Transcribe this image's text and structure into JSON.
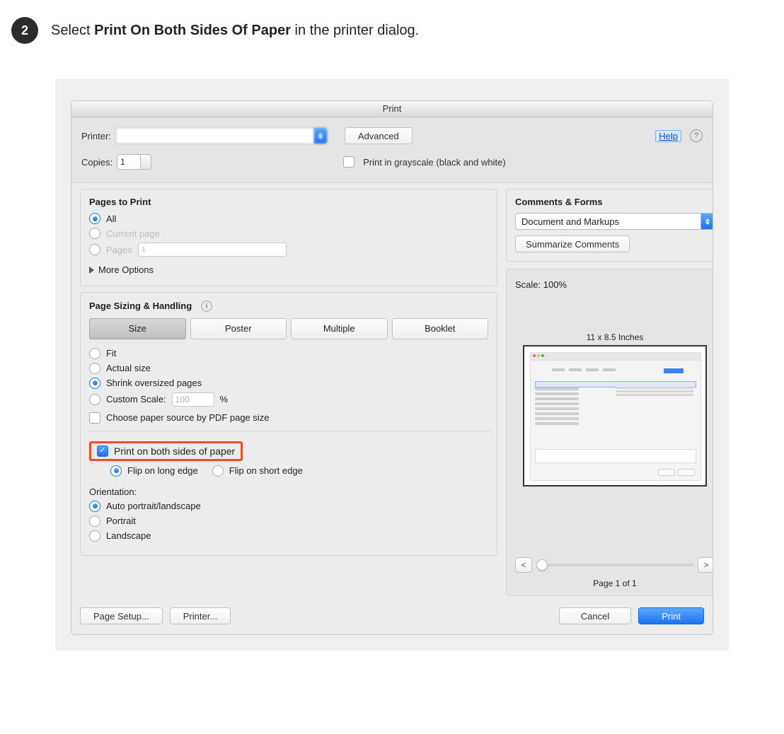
{
  "step": {
    "number": "2",
    "prefix": "Select ",
    "bold": "Print On Both Sides Of Paper",
    "suffix": " in the printer dialog."
  },
  "dialog": {
    "title": "Print",
    "printer_label": "Printer:",
    "printer_value": "",
    "advanced_btn": "Advanced",
    "help_link": "Help",
    "copies_label": "Copies:",
    "copies_value": "1",
    "grayscale_label": "Print in grayscale (black and white)"
  },
  "pages": {
    "title": "Pages to Print",
    "all": "All",
    "current": "Current page",
    "pages_label": "Pages",
    "pages_value": "1",
    "more_options": "More Options"
  },
  "sizing": {
    "title": "Page Sizing & Handling",
    "tabs": {
      "size": "Size",
      "poster": "Poster",
      "multiple": "Multiple",
      "booklet": "Booklet"
    },
    "fit": "Fit",
    "actual": "Actual size",
    "shrink": "Shrink oversized pages",
    "custom_label": "Custom Scale:",
    "custom_value": "100",
    "percent": "%",
    "choose_source": "Choose paper source by PDF page size",
    "both_sides": "Print on both sides of paper",
    "flip_long": "Flip on long edge",
    "flip_short": "Flip on short edge",
    "orientation_label": "Orientation:",
    "auto": "Auto portrait/landscape",
    "portrait": "Portrait",
    "landscape": "Landscape"
  },
  "comments": {
    "title": "Comments & Forms",
    "select_value": "Document and Markups",
    "summarize_btn": "Summarize Comments"
  },
  "preview": {
    "scale_label": "Scale: 100%",
    "size_caption": "11 x 8.5 Inches",
    "prev": "<",
    "next": ">",
    "page_of": "Page 1 of 1"
  },
  "footer": {
    "page_setup": "Page Setup...",
    "printer": "Printer...",
    "cancel": "Cancel",
    "print": "Print"
  }
}
